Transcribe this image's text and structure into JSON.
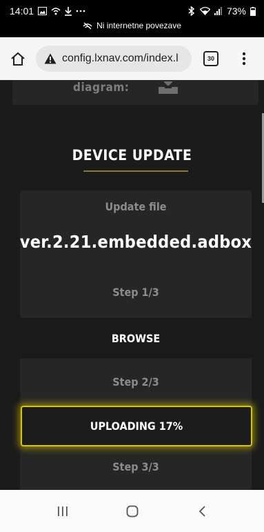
{
  "status_bar": {
    "time": "14:01",
    "battery": "73%",
    "connection_notice": "Ni internetne povezave"
  },
  "browser": {
    "url": "config.lxnav.com/index.l",
    "tab_count": "30"
  },
  "page": {
    "diagram_label": "diagram:",
    "section_title": "DEVICE UPDATE",
    "update_file_label": "Update file",
    "filename": "ver.2.21.embedded.adbox",
    "step1_label": "Step 1/3",
    "browse_label": "BROWSE",
    "step2_label": "Step 2/3",
    "upload_status": "UPLOADING 17%",
    "upload_progress_percent": 17,
    "step3_label": "Step 3/3"
  },
  "colors": {
    "accent": "#d9c500",
    "page_bg": "#1b1b1b",
    "card_bg": "#262626"
  }
}
